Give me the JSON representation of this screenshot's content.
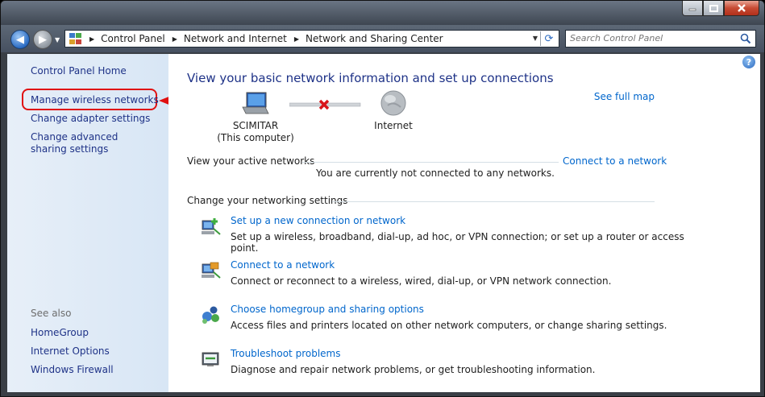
{
  "address": {
    "crumbs": [
      "Control Panel",
      "Network and Internet",
      "Network and Sharing Center"
    ]
  },
  "search": {
    "placeholder": "Search Control Panel"
  },
  "sidebar": {
    "home": "Control Panel Home",
    "links": [
      "Manage wireless networks",
      "Change adapter settings",
      "Change advanced sharing settings"
    ],
    "see_also_title": "See also",
    "see_also": [
      "HomeGroup",
      "Internet Options",
      "Windows Firewall"
    ]
  },
  "main": {
    "heading": "View your basic network information and set up connections",
    "see_full_map": "See full map",
    "computer_name": "SCIMITAR",
    "computer_sub": "(This computer)",
    "internet_label": "Internet",
    "active_title": "View your active networks",
    "connect_link": "Connect to a network",
    "not_connected": "You are currently not connected to any networks.",
    "settings_title": "Change your networking settings",
    "tasks": [
      {
        "title": "Set up a new connection or network",
        "desc": "Set up a wireless, broadband, dial-up, ad hoc, or VPN connection; or set up a router or access point."
      },
      {
        "title": "Connect to a network",
        "desc": "Connect or reconnect to a wireless, wired, dial-up, or VPN network connection."
      },
      {
        "title": "Choose homegroup and sharing options",
        "desc": "Access files and printers located on other network computers, or change sharing settings."
      },
      {
        "title": "Troubleshoot problems",
        "desc": "Diagnose and repair network problems, or get troubleshooting information."
      }
    ]
  },
  "colors": {
    "link": "#0066cc",
    "nav_link": "#1e3287",
    "highlight": "#e01010"
  }
}
